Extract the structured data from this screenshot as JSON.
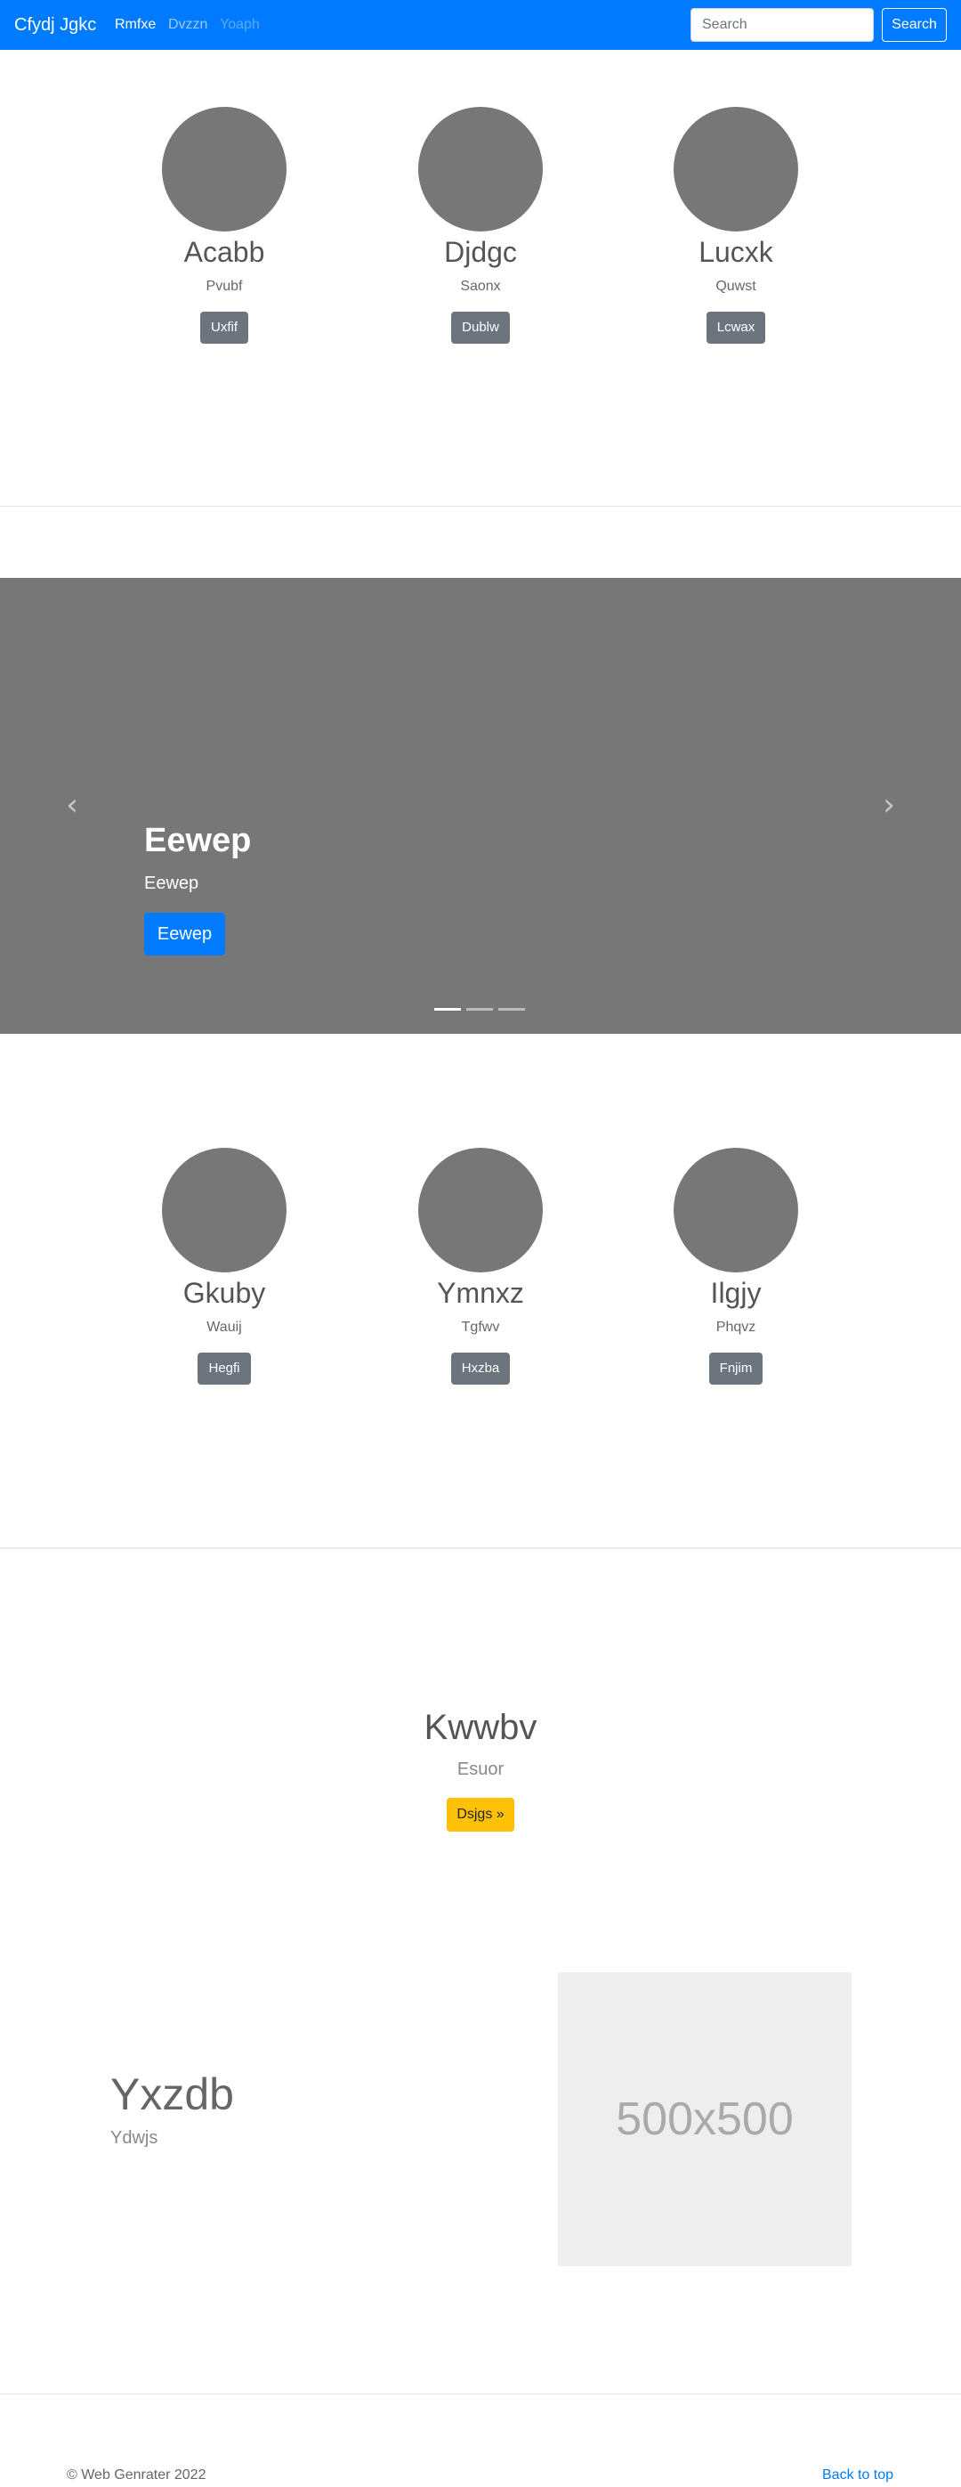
{
  "navbar": {
    "brand": "Cfydj Jgkc",
    "links": [
      "Rmfxe",
      "Dvzzn",
      "Yoaph"
    ],
    "search_placeholder": "Search",
    "search_button": "Search"
  },
  "profiles_top": [
    {
      "name": "Acabb",
      "text": "Pvubf",
      "button": "Uxfif"
    },
    {
      "name": "Djdgc",
      "text": "Saonx",
      "button": "Dublw"
    },
    {
      "name": "Lucxk",
      "text": "Quwst",
      "button": "Lcwax"
    }
  ],
  "carousel": {
    "title": "Eewep",
    "subtitle": "Eewep",
    "button": "Eewep",
    "prev_icon": "chevron-left-icon",
    "next_icon": "chevron-right-icon",
    "slide_count": 3,
    "active_slide": 1
  },
  "profiles_bottom": [
    {
      "name": "Gkuby",
      "text": "Wauij",
      "button": "Hegfi"
    },
    {
      "name": "Ymnxz",
      "text": "Tgfwv",
      "button": "Hxzba"
    },
    {
      "name": "Ilgjy",
      "text": "Phqvz",
      "button": "Fnjim"
    }
  ],
  "hero": {
    "title": "Kwwbv",
    "subtitle": "Esuor",
    "button": "Dsjgs »"
  },
  "feature": {
    "title": "Yxzdb",
    "subtitle": "Ydwjs",
    "image_label": "500x500"
  },
  "footer": {
    "copyright": "© Web Genrater 2022",
    "back_to_top": "Back to top"
  },
  "colors": {
    "primary": "#007bff",
    "secondary": "#6c757d",
    "warning": "#ffc107",
    "placeholder_gray": "#777777"
  }
}
